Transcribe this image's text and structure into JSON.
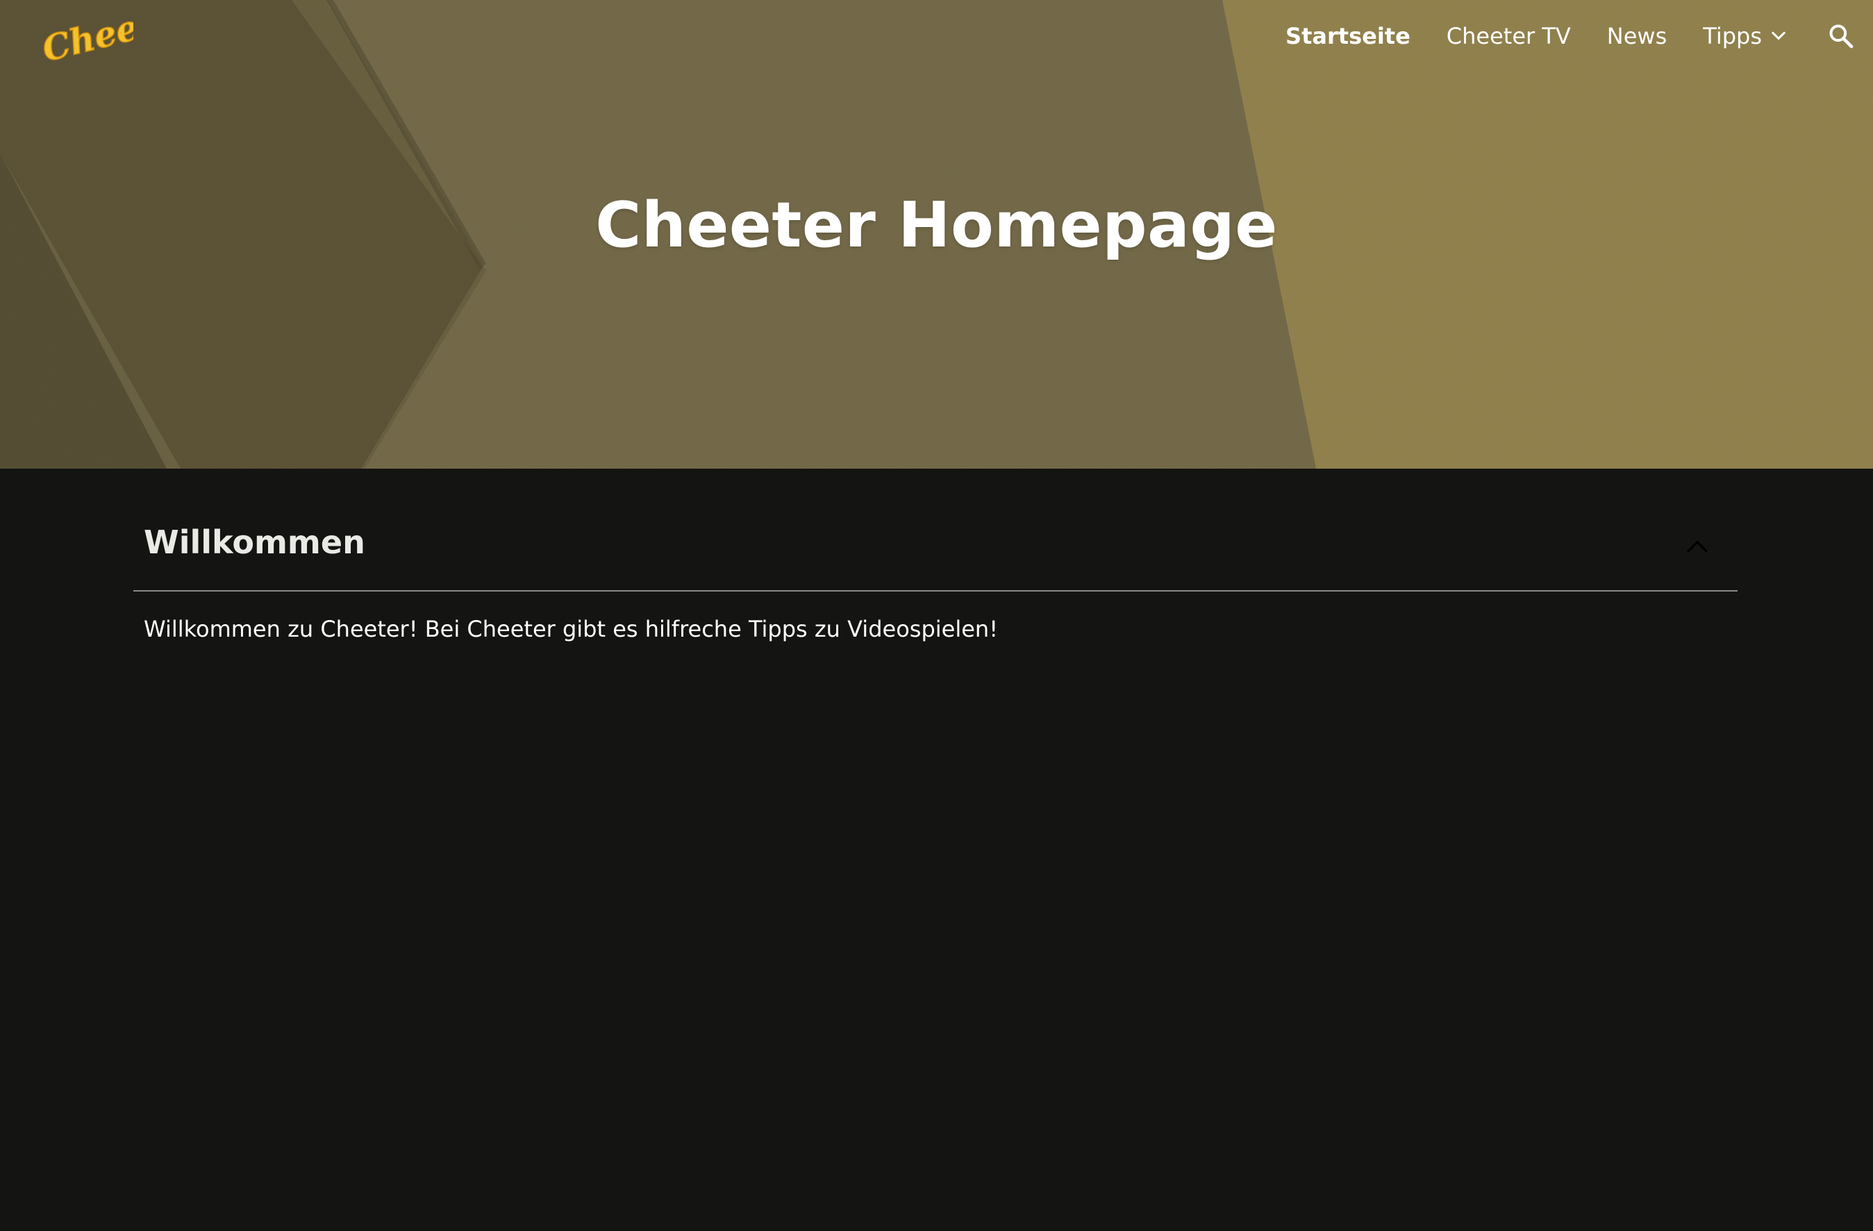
{
  "header": {
    "logo_text": "Cheeter",
    "nav": [
      {
        "label": "Startseite",
        "active": true
      },
      {
        "label": "Cheeter TV",
        "active": false
      },
      {
        "label": "News",
        "active": false
      },
      {
        "label": "Tipps",
        "active": false,
        "dropdown": true
      }
    ],
    "search_icon": "search-icon"
  },
  "hero": {
    "title": "Cheeter Homepage"
  },
  "section": {
    "title": "Willkommen",
    "expanded": true,
    "body": "Willkommen zu Cheeter! Bei Cheeter gibt es hilfreche Tipps zu Videospielen!"
  },
  "colors": {
    "page_background": "#141412",
    "hero_background": "#766c4b",
    "logo": "#f5c22a",
    "text": "#ffffff"
  }
}
